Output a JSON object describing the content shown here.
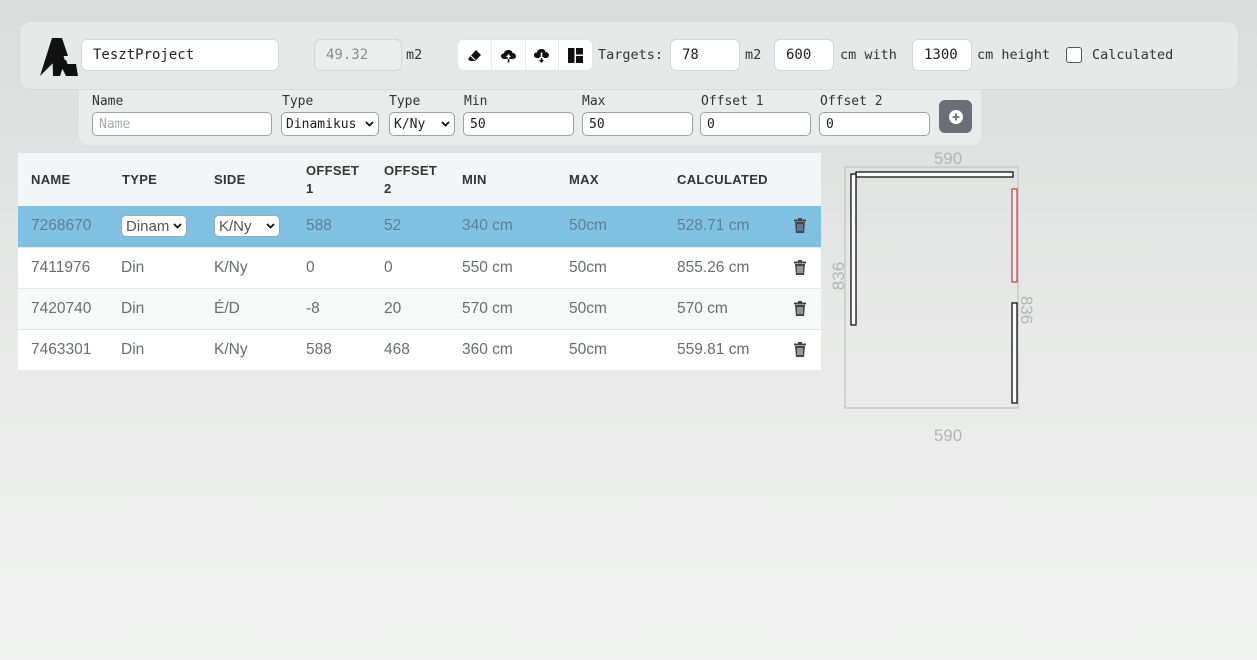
{
  "header": {
    "logo_icon": "app-logo-icon",
    "project_name": "TesztProject",
    "area_value": "49.32",
    "area_unit": "m2",
    "tools": [
      "eraser-icon",
      "cloud-upload-icon",
      "cloud-download-icon",
      "layout-icon"
    ],
    "targets_label": "Targets:",
    "target_area": "78",
    "target_area_unit": "m2",
    "target_width": "600",
    "width_label": "cm with",
    "target_height": "1300",
    "height_label": "cm height",
    "calculated_label": "Calculated",
    "calculated_checked": false
  },
  "form": {
    "labels": {
      "name": "Name",
      "type1": "Type",
      "type2": "Type",
      "min": "Min",
      "max": "Max",
      "offset1": "Offset 1",
      "offset2": "Offset 2"
    },
    "name_placeholder": "Name",
    "type1_value": "Dinamikus",
    "type2_value": "K/Ny",
    "min_value": "50",
    "max_value": "50",
    "offset1_value": "0",
    "offset2_value": "0",
    "add_icon": "plus-circle-icon"
  },
  "table": {
    "headers": [
      "NAME",
      "TYPE",
      "SIDE",
      "OFFSET 1",
      "OFFSET 2",
      "MIN",
      "MAX",
      "CALCULATED"
    ],
    "header_lines": {
      "offset1": [
        "OFFSET",
        "1"
      ],
      "offset2": [
        "OFFSET",
        "2"
      ]
    },
    "rows": [
      {
        "name": "7268670",
        "type": "Dinam",
        "side": "K/Ny",
        "offset1": "588",
        "offset2": "52",
        "min": "340 cm",
        "max": "50cm",
        "calculated": "528.71 cm",
        "selected": true
      },
      {
        "name": "7411976",
        "type": "Din",
        "side": "K/Ny",
        "offset1": "0",
        "offset2": "0",
        "min": "550 cm",
        "max": "50cm",
        "calculated": "855.26 cm",
        "selected": false
      },
      {
        "name": "7420740",
        "type": "Din",
        "side": "É/D",
        "offset1": "-8",
        "offset2": "20",
        "min": "570 cm",
        "max": "50cm",
        "calculated": "570 cm",
        "selected": false
      },
      {
        "name": "7463301",
        "type": "Din",
        "side": "K/Ny",
        "offset1": "588",
        "offset2": "468",
        "min": "360 cm",
        "max": "50cm",
        "calculated": "559.81 cm",
        "selected": false
      }
    ],
    "row_action_icon": "trash-icon"
  },
  "plan": {
    "top_dimension": "590",
    "bottom_dimension": "590",
    "left_dimension": "836",
    "right_dimension": "836",
    "highlight_color": "#e03a3a"
  }
}
